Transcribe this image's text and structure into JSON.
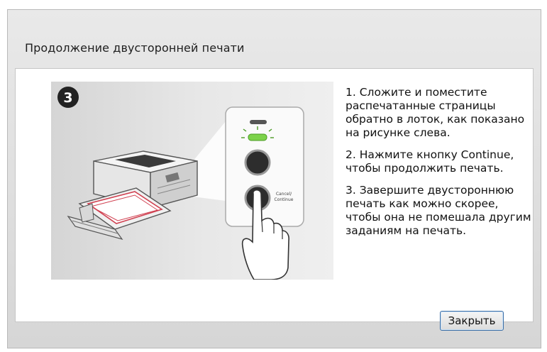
{
  "dialog": {
    "title": "Продолжение двусторонней печати",
    "close_label": "Закрыть"
  },
  "illustration": {
    "step_number": "3",
    "button_label_line1": "Cancel/",
    "button_label_line2": "Continue"
  },
  "instructions": [
    "1. Сложите и поместите распечатанные страницы обратно в лоток, как показано на рисунке слева.",
    "2. Нажмите кнопку Continue, чтобы продолжить печать.",
    "3. Завершите двустороннюю печать как можно скорее, чтобы она не помешала другим заданиям на печать."
  ]
}
